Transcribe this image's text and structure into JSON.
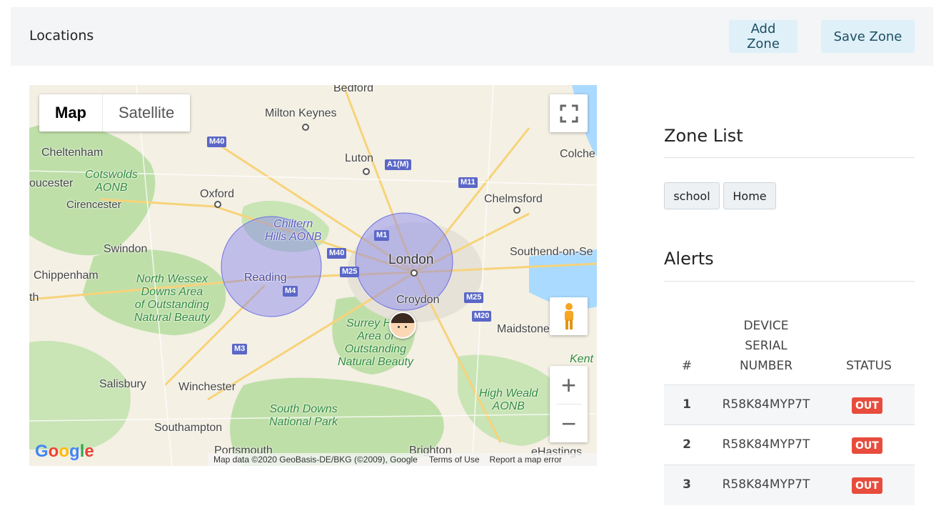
{
  "header": {
    "title": "Locations",
    "add_zone": "Add Zone",
    "save_zone": "Save Zone"
  },
  "map": {
    "type_options": [
      "Map",
      "Satellite"
    ],
    "active_type": "Map",
    "places": {
      "bedford": "Bedford",
      "milton_keynes": "Milton Keynes",
      "cheltenham": "Cheltenham",
      "luton": "Luton",
      "colchester": "Colche",
      "gloucester": "oucester",
      "cotswolds": "Cotswolds\nAONB",
      "oxford": "Oxford",
      "chelmsford": "Chelmsford",
      "cirencester": "Cirencester",
      "chiltern": "Chiltern\nHills AONB",
      "swindon": "Swindon",
      "london": "London",
      "southend": "Southend-on-Se",
      "chippenham": "Chippenham",
      "north_wessex": "North Wessex\nDowns Area\nof Outstanding\nNatural Beauty",
      "reading": "Reading",
      "croydon": "Croydon",
      "bath": "th",
      "surrey": "Surrey Hills\nArea of\nOutstanding\nNatural Beauty",
      "maidstone": "Maidstone",
      "kent": "Kent\nA",
      "salisbury": "Salisbury",
      "winchester": "Winchester",
      "high_weald": "High Weald\nAONB",
      "south_downs": "South Downs\nNational Park",
      "southampton": "Southampton",
      "portsmouth": "Portsmouth",
      "brighton": "Brighton",
      "hastings": "eHastings"
    },
    "roads": {
      "m40a": "M40",
      "a1m": "A1(M)",
      "m11": "M11",
      "m1": "M1",
      "m40b": "M40",
      "m25a": "M25",
      "m4": "M4",
      "m25b": "M25",
      "m20": "M20",
      "m3": "M3"
    },
    "zone_colors": {
      "fill": "#8080f0",
      "stroke": "#7070e0"
    },
    "logo": "Google",
    "attribution": "Map data ©2020 GeoBasis-DE/BKG (©2009), Google",
    "terms": "Terms of Use",
    "report": "Report a map error",
    "zoom_in": "+",
    "zoom_out": "−"
  },
  "zone_list": {
    "title": "Zone List",
    "zones": [
      "school",
      "Home"
    ]
  },
  "alerts": {
    "title": "Alerts",
    "columns": {
      "index": "#",
      "serial_line1": "DEVICE",
      "serial_line2": "SERIAL",
      "serial_line3": "NUMBER",
      "status": "STATUS"
    },
    "rows": [
      {
        "index": "1",
        "serial": "R58K84MYP7T",
        "status": "OUT"
      },
      {
        "index": "2",
        "serial": "R58K84MYP7T",
        "status": "OUT"
      },
      {
        "index": "3",
        "serial": "R58K84MYP7T",
        "status": "OUT"
      }
    ],
    "status_color": "#e74c3c"
  }
}
